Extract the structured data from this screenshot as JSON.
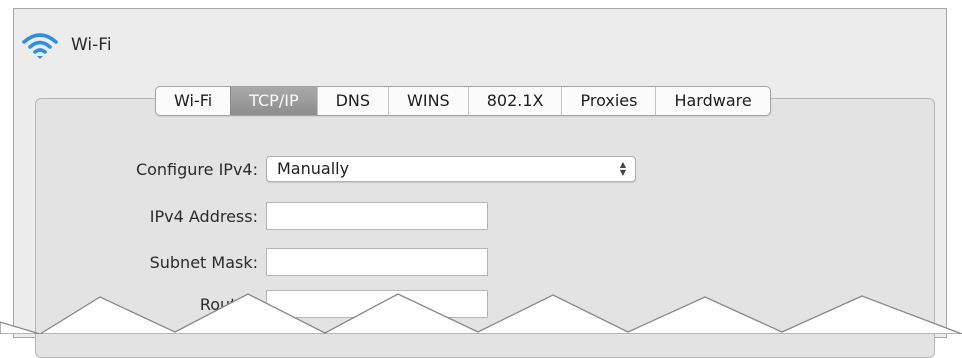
{
  "header": {
    "title": "Wi-Fi",
    "icon": "wifi-icon"
  },
  "tabs": [
    {
      "label": "Wi-Fi",
      "selected": false
    },
    {
      "label": "TCP/IP",
      "selected": true
    },
    {
      "label": "DNS",
      "selected": false
    },
    {
      "label": "WINS",
      "selected": false
    },
    {
      "label": "802.1X",
      "selected": false
    },
    {
      "label": "Proxies",
      "selected": false
    },
    {
      "label": "Hardware",
      "selected": false
    }
  ],
  "form": {
    "configure_ipv4": {
      "label": "Configure IPv4:",
      "value": "Manually"
    },
    "ipv4_address": {
      "label": "IPv4 Address:",
      "value": ""
    },
    "subnet_mask": {
      "label": "Subnet Mask:",
      "value": ""
    },
    "router": {
      "label": "Router:",
      "value": ""
    }
  },
  "colors": {
    "wifi_blue": "#2f8fe4",
    "selected_tab": "#9b9b9b",
    "panel_bg": "#e3e3e3"
  }
}
